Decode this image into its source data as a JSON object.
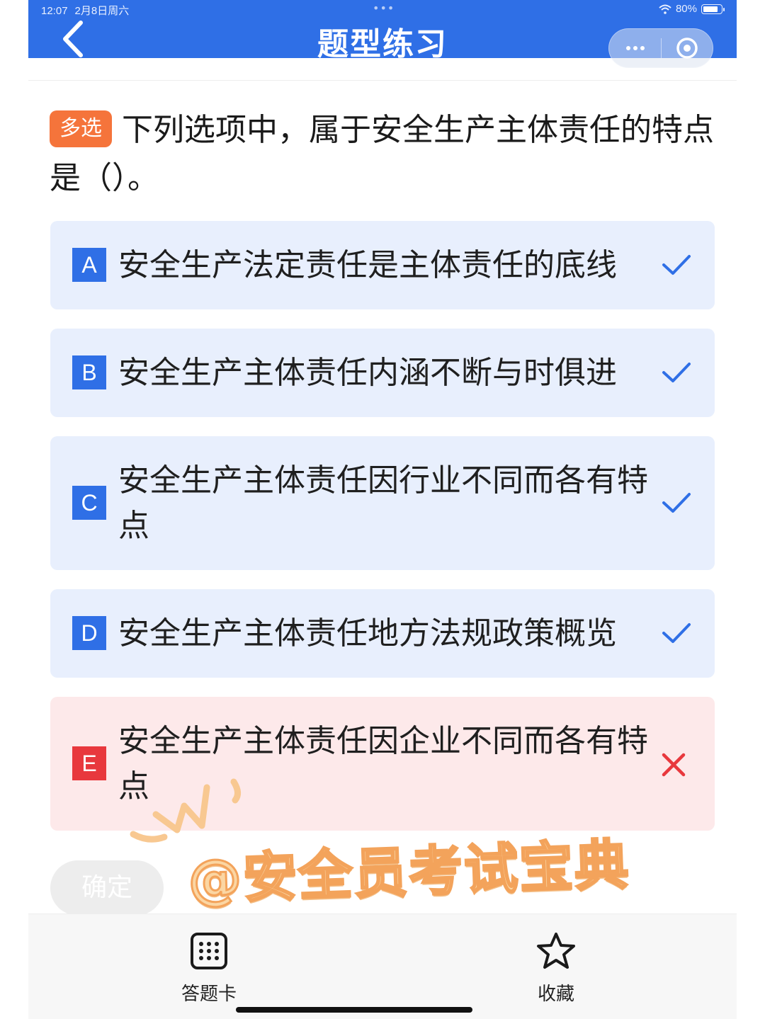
{
  "status_bar": {
    "time": "12:07",
    "date": "2月8日周六",
    "battery": "80%"
  },
  "nav": {
    "title": "题型练习",
    "back_icon": "chevron-left-icon",
    "more_icon": "more-dots-icon",
    "close_icon": "target-circle-icon"
  },
  "question": {
    "type_tag": "多选",
    "text": "下列选项中，属于安全生产主体责任的特点是（）。"
  },
  "options": [
    {
      "letter": "A",
      "text": "安全生产法定责任是主体责任的底线",
      "status": "correct"
    },
    {
      "letter": "B",
      "text": "安全生产主体责任内涵不断与时俱进",
      "status": "correct"
    },
    {
      "letter": "C",
      "text": "安全生产主体责任因行业不同而各有特点",
      "status": "correct"
    },
    {
      "letter": "D",
      "text": "安全生产主体责任地方法规政策概览",
      "status": "correct"
    },
    {
      "letter": "E",
      "text": "安全生产主体责任因企业不同而各有特点",
      "status": "wrong"
    }
  ],
  "confirm_label": "确定",
  "watermark": "@安全员考试宝典",
  "bottom_tabs": {
    "answer_card": "答题卡",
    "favorite": "收藏"
  },
  "colors": {
    "primary": "#2f6fe6",
    "tag": "#f5743b",
    "option_bg": "#e8effd",
    "wrong_bg": "#fde9ea",
    "wrong": "#e8383d"
  }
}
